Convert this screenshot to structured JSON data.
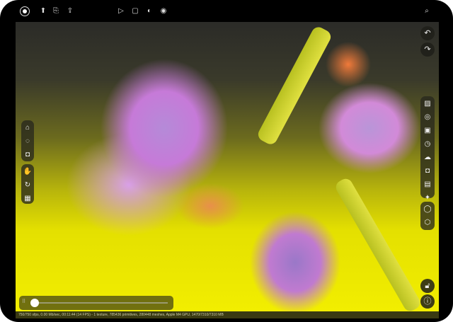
{
  "toolbar_left": [
    {
      "icon": "render-record-icon"
    },
    {
      "icon": "import-icon"
    },
    {
      "icon": "save-icon"
    },
    {
      "icon": "share-icon"
    }
  ],
  "toolbar_center": [
    {
      "icon": "play-icon"
    },
    {
      "icon": "stop-icon"
    },
    {
      "icon": "viewport-toggle-icon"
    },
    {
      "icon": "settings-icon"
    }
  ],
  "toolbar_right": [
    {
      "icon": "zoom-icon"
    }
  ],
  "right_top": [
    {
      "icon": "undo-icon"
    },
    {
      "icon": "redo-icon"
    }
  ],
  "left_tools_group1": [
    {
      "icon": "object-picker-icon"
    },
    {
      "icon": "focus-picker-icon"
    },
    {
      "icon": "camera-icon"
    }
  ],
  "left_tools_group2": [
    {
      "icon": "pan-hand-icon"
    },
    {
      "icon": "rotate-hand-icon"
    },
    {
      "icon": "checker-icon"
    }
  ],
  "right_tools_group1": [
    {
      "icon": "image-icon"
    },
    {
      "icon": "target-icon"
    },
    {
      "icon": "render-image-icon"
    },
    {
      "icon": "timer-icon"
    },
    {
      "icon": "weather-icon"
    },
    {
      "icon": "camera-icon"
    },
    {
      "icon": "gallery-icon"
    },
    {
      "icon": "sparkle-icon"
    }
  ],
  "right_tools_group2": [
    {
      "icon": "refresh-icon"
    },
    {
      "icon": "material-icon"
    }
  ],
  "right_bottom": [
    {
      "icon": "unlock-icon"
    },
    {
      "icon": "info-icon"
    }
  ],
  "timeline": {
    "progress": 0
  },
  "status_text": "750/750 sfps, 0.00 Mb/sec, 00:11:44 (14 FPS) - 1 texture, 785436 primitives, 280448 meshes, Apple M4 GPU, 1470/7310/7310 MB"
}
